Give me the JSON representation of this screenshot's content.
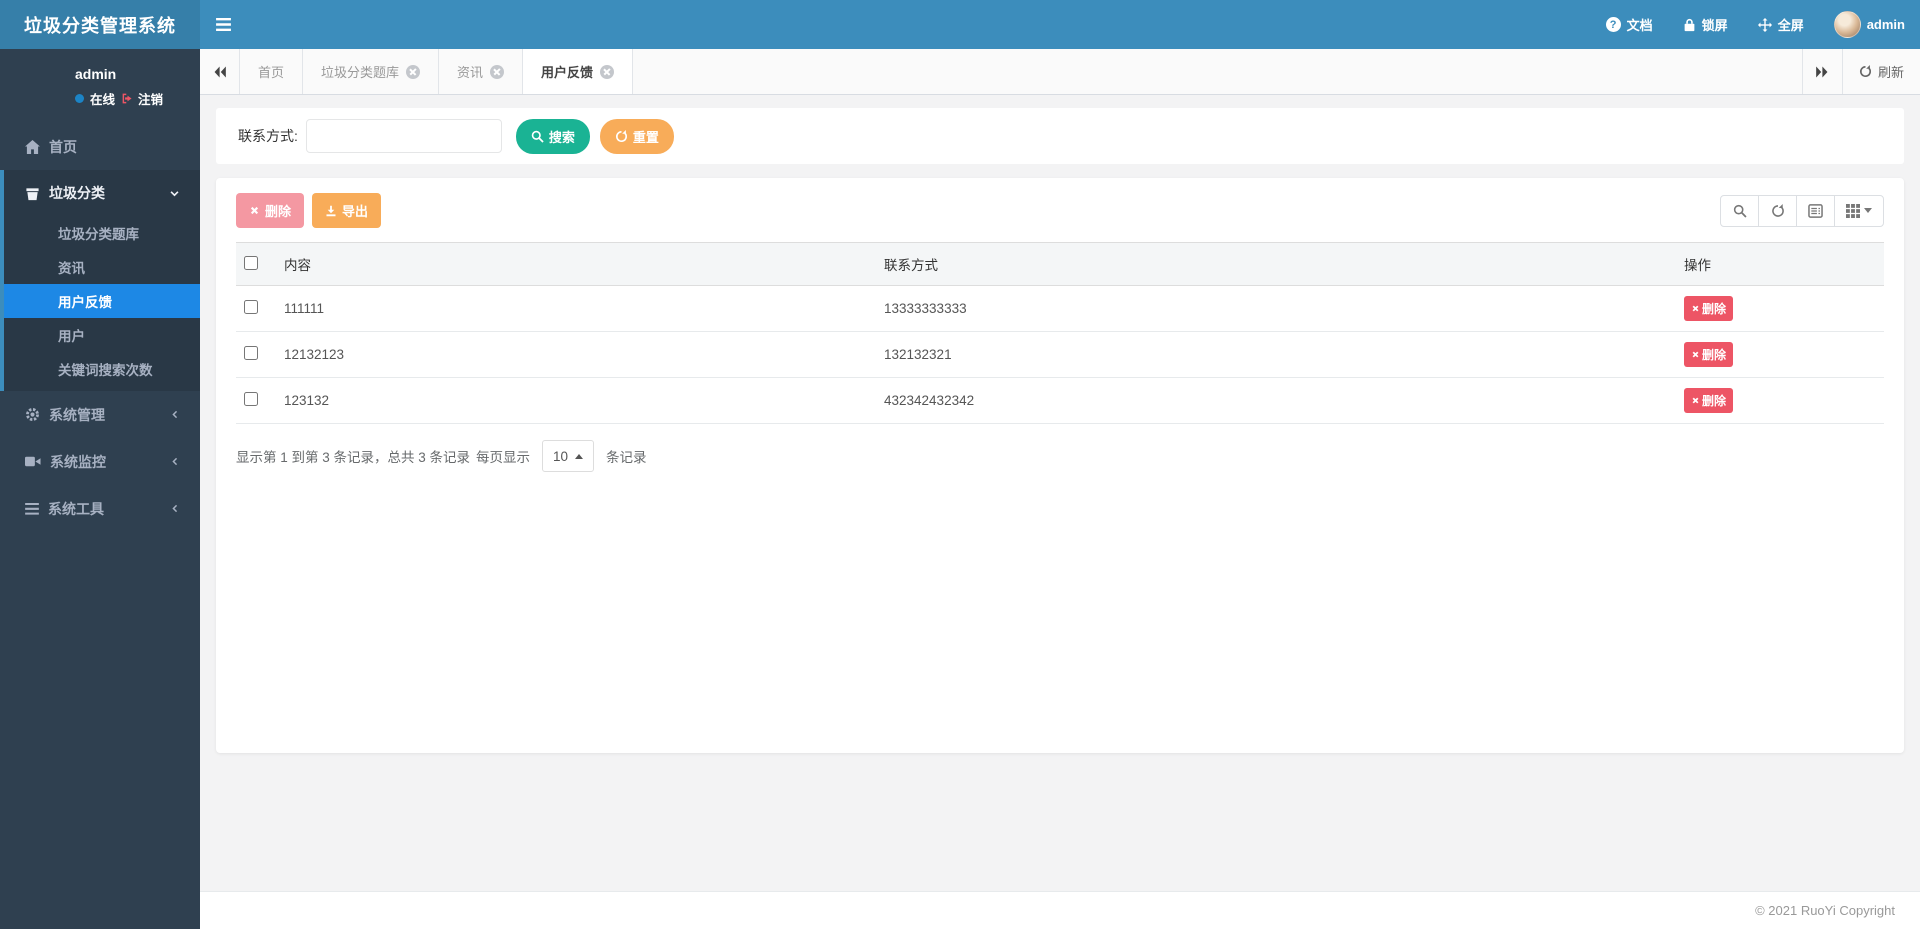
{
  "colors": {
    "header_blue": "#3c8dbc",
    "brand_blue": "#367fa9",
    "sidebar_dark": "#2f4050",
    "submenu_dark": "#293846",
    "active_item_blue": "#1d88e5",
    "success_green": "#1ab394",
    "warning_orange": "#f8ac59",
    "danger_red": "#ed5565"
  },
  "header": {
    "brand": "垃圾分类管理系统",
    "nav": {
      "docs": "文档",
      "lock": "锁屏",
      "fullscreen": "全屏",
      "username": "admin"
    }
  },
  "sidebar": {
    "user": {
      "name": "admin",
      "status": "在线",
      "logout": "注销"
    },
    "home": {
      "label": "首页"
    },
    "garbage": {
      "label": "垃圾分类",
      "items": [
        {
          "label": "垃圾分类题库"
        },
        {
          "label": "资讯"
        },
        {
          "label": "用户反馈"
        },
        {
          "label": "用户"
        },
        {
          "label": "关键词搜索次数"
        }
      ]
    },
    "collapsed": [
      {
        "label": "系统管理"
      },
      {
        "label": "系统监控"
      },
      {
        "label": "系统工具"
      }
    ]
  },
  "tabs": {
    "items": [
      {
        "label": "首页"
      },
      {
        "label": "垃圾分类题库"
      },
      {
        "label": "资讯"
      },
      {
        "label": "用户反馈"
      }
    ],
    "refresh": "刷新"
  },
  "search": {
    "label": "联系方式:",
    "value": "",
    "search_btn": "搜索",
    "reset_btn": "重置"
  },
  "toolbar": {
    "delete": "删除",
    "export": "导出"
  },
  "table": {
    "headers": [
      "内容",
      "联系方式",
      "操作"
    ],
    "rows": [
      {
        "content": "111111",
        "contact": "13333333333",
        "action": "删除"
      },
      {
        "content": "12132123",
        "contact": "132132321",
        "action": "删除"
      },
      {
        "content": "123132",
        "contact": "432342432342",
        "action": "删除"
      }
    ]
  },
  "pagination": {
    "info": "显示第 1 到第 3 条记录，总共 3 条记录",
    "per_page_prefix": "每页显示",
    "page_size": "10",
    "per_page_suffix": "条记录"
  },
  "footer": {
    "copyright": "© 2021 RuoYi Copyright"
  }
}
